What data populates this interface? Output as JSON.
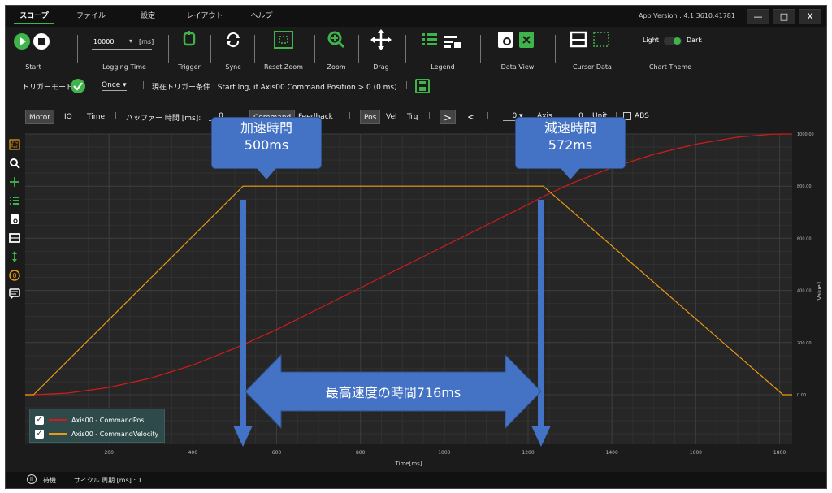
{
  "menu": {
    "items": [
      {
        "label": "スコープ",
        "active": true
      },
      {
        "label": "ファイル",
        "active": false
      },
      {
        "label": "設定",
        "active": false
      },
      {
        "label": "レイアウト",
        "active": false
      },
      {
        "label": "ヘルプ",
        "active": false
      }
    ],
    "app_version": "App Version : 4.1.3610.41781",
    "minimize": "—",
    "maximize": "□",
    "close": "X"
  },
  "toolbar": {
    "start_label": "Start",
    "logging_time_value": "10000",
    "logging_time_unit": "[ms]",
    "logging_time_label": "Logging Time",
    "trigger_label": "Trigger",
    "sync_label": "Sync",
    "reset_zoom_label": "Reset Zoom",
    "zoom_label": "Zoom",
    "drag_label": "Drag",
    "legend_label": "Legend",
    "data_view_label": "Data View",
    "cursor_data_label": "Cursor Data",
    "theme_light": "Light",
    "theme_dark": "Dark",
    "chart_theme_label": "Chart Theme"
  },
  "trigger": {
    "mode_label": "トリガーモード",
    "mode_value": "Once",
    "condition": "現在トリガー条件 : Start log, if Axis00 Command Position > 0 (0 ms)"
  },
  "filters": {
    "motor": "Motor",
    "io": "IO",
    "time": "Time",
    "buffer_label": "バッファー 時間 [ms]:",
    "buffer_value": "0",
    "command": "Command",
    "feedback": "Feedback",
    "pos": "Pos",
    "vel": "Vel",
    "trq": "Trq",
    "next": ">",
    "prev": "<",
    "axis_value": "0",
    "axis_label": "Axis",
    "unit_value": "0",
    "unit_label": "Unit",
    "abs_label": "ABS"
  },
  "status": {
    "state": "待機",
    "cycle": "サイクル 周期 [ms] : 1"
  },
  "annotations": {
    "accel_title": "加速時間",
    "accel_value": "500ms",
    "decel_title": "減速時間",
    "decel_value": "572ms",
    "max_speed": "最高速度の時間716ms"
  },
  "colors": {
    "accent": "#3fb44a",
    "command_pos": "#d11b1b",
    "command_velocity": "#e89a14",
    "callout": "#4472c4"
  },
  "chart_data": {
    "type": "line",
    "xlabel": "Time[ms]",
    "ylabel": "Value1",
    "xlim": [
      0,
      1830
    ],
    "ylim": [
      -190,
      1000
    ],
    "x_ticks": [
      200,
      400,
      600,
      800,
      1000,
      1200,
      1400,
      1600,
      1800
    ],
    "y_ticks": [
      "0.00",
      "200.00",
      "400.00",
      "600.00",
      "800.00",
      "1000.00"
    ],
    "y_tick_values": [
      0,
      200,
      400,
      600,
      800,
      1000
    ],
    "grid": true,
    "legend_position": "bottom-left",
    "series": [
      {
        "name": "Axis00 - CommandPos",
        "color": "#d11b1b",
        "x": [
          0,
          20,
          100,
          200,
          300,
          400,
          500,
          520,
          600,
          700,
          800,
          900,
          1000,
          1100,
          1200,
          1236,
          1300,
          1400,
          1500,
          1600,
          1700,
          1780,
          1808,
          1830
        ],
        "y": [
          0,
          0,
          6,
          28,
          64,
          114,
          178,
          192,
          250,
          330,
          410,
          490,
          570,
          650,
          730,
          760,
          808,
          871,
          922,
          961,
          988,
          999,
          1000,
          1000
        ]
      },
      {
        "name": "Axis00 - CommandVelocity",
        "color": "#e89a14",
        "x": [
          0,
          20,
          520,
          1236,
          1808,
          1830
        ],
        "y": [
          0,
          0,
          800,
          800,
          0,
          0
        ]
      }
    ]
  }
}
